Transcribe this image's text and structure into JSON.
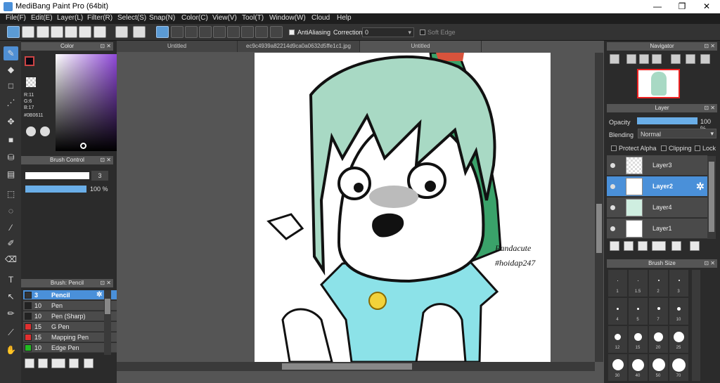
{
  "window": {
    "title": "MediBang Paint Pro (64bit)"
  },
  "menu": [
    "File(F)",
    "Edit(E)",
    "Layer(L)",
    "Filter(R)",
    "Select(S)",
    "Snap(N)",
    "Color(C)",
    "View(V)",
    "Tool(T)",
    "Window(W)",
    "Cloud",
    "Help"
  ],
  "toolbar": {
    "antialiasing": "AntiAliasing",
    "correction_label": "Correction",
    "correction_value": "0",
    "soft_edge": "Soft Edge"
  },
  "color_panel": {
    "title": "Color",
    "r": "R:11",
    "g": "G:6",
    "b": "B:17",
    "hex": "#0B0611"
  },
  "brush_control": {
    "title": "Brush Control",
    "size": "3",
    "opacity": "100 %"
  },
  "brush_panel": {
    "title": "Brush: Pencil",
    "items": [
      {
        "size": "3",
        "name": "Pencil",
        "color": "#333333"
      },
      {
        "size": "10",
        "name": "Pen",
        "color": "#222222"
      },
      {
        "size": "10",
        "name": "Pen (Sharp)",
        "color": "#222222"
      },
      {
        "size": "15",
        "name": "G Pen",
        "color": "#e03030"
      },
      {
        "size": "15",
        "name": "Mapping Pen",
        "color": "#e03030"
      },
      {
        "size": "10",
        "name": "Edge Pen",
        "color": "#22bb22"
      }
    ]
  },
  "tabs": [
    "Untitled",
    "ec9c4939a82214d9ca0a0632d5ffe1c1.jpg",
    "Untitled"
  ],
  "artwork": {
    "signature_line1": "Pandacute",
    "signature_line2": "#hoidap247"
  },
  "navigator": {
    "title": "Navigator"
  },
  "layer_panel": {
    "title": "Layer",
    "opacity_label": "Opacity",
    "opacity_value": "100 %",
    "blending_label": "Blending",
    "blending_value": "Normal",
    "protect_alpha": "Protect Alpha",
    "clipping": "Clipping",
    "lock": "Lock",
    "layers": [
      "Layer3",
      "Layer2",
      "Layer4",
      "Layer1"
    ]
  },
  "brush_size": {
    "title": "Brush Size",
    "labels": [
      [
        "1",
        "1.5",
        "2",
        "3"
      ],
      [
        "4",
        "5",
        "7",
        "10"
      ],
      [
        "12",
        "15",
        "20",
        "25"
      ],
      [
        "30",
        "40",
        "50",
        "70"
      ]
    ]
  },
  "colors": {
    "accent": "#4a90d9",
    "foreground": "#0B0611"
  }
}
